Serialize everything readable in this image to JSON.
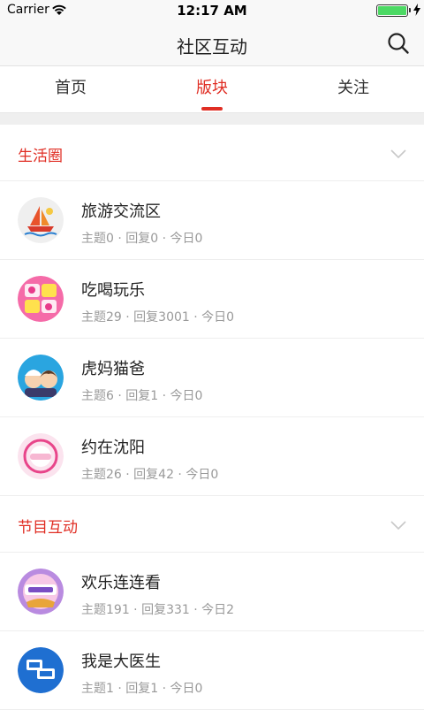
{
  "status_bar": {
    "carrier": "Carrier",
    "time": "12:17 AM"
  },
  "nav": {
    "title": "社区互动"
  },
  "tabs": [
    {
      "label": "首页"
    },
    {
      "label": "版块"
    },
    {
      "label": "关注"
    }
  ],
  "sections": [
    {
      "title": "生活圈",
      "items": [
        {
          "name": "旅游交流区",
          "meta": "主题0 · 回复0 · 今日0"
        },
        {
          "name": "吃喝玩乐",
          "meta": "主题29 · 回复3001 · 今日0"
        },
        {
          "name": "虎妈猫爸",
          "meta": "主题6 · 回复1 · 今日0"
        },
        {
          "name": "约在沈阳",
          "meta": "主题26 · 回复42 · 今日0"
        }
      ]
    },
    {
      "title": "节目互动",
      "items": [
        {
          "name": "欢乐连连看",
          "meta": "主题191 · 回复331 · 今日2"
        },
        {
          "name": "我是大医生",
          "meta": "主题1 · 回复1 · 今日0"
        }
      ]
    }
  ],
  "colors": {
    "accent": "#e02e24",
    "battery": "#4cd964"
  }
}
